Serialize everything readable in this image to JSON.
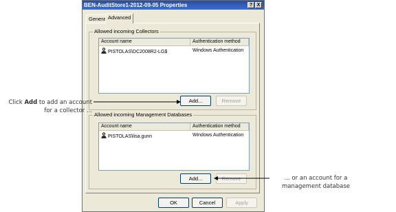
{
  "window": {
    "title": "BEN-AuditStore1-2012-09-05 Properties",
    "help_label": "?",
    "close_label": "X"
  },
  "tabs": [
    {
      "label": "General"
    },
    {
      "label": "Advanced"
    }
  ],
  "collectors": {
    "legend": "Allowed incoming Collectors",
    "columns": [
      "Account name",
      "Authentication method"
    ],
    "rows": [
      {
        "account": "PISTOLAS\\DC2008R2-LG$",
        "auth": "Windows Authentication",
        "icon": "user-icon"
      }
    ],
    "add_label": "Add...",
    "remove_label": "Remove"
  },
  "management": {
    "legend": "Allowed incoming Management Databases",
    "columns": [
      "Account name",
      "Authentication method"
    ],
    "rows": [
      {
        "account": "PISTOLAS\\lisa.gunn",
        "auth": "Windows Authentication",
        "icon": "user-icon"
      }
    ],
    "add_label": "Add...",
    "remove_label": "Remove"
  },
  "footer": {
    "ok_label": "OK",
    "cancel_label": "Cancel",
    "apply_label": "Apply"
  },
  "annotations": {
    "left_pre": "Click ",
    "left_bold": "Add",
    "left_post": " to add an account",
    "left_line2": "for a collector ...",
    "right_line1": "... or an account for a",
    "right_line2": "management database"
  }
}
